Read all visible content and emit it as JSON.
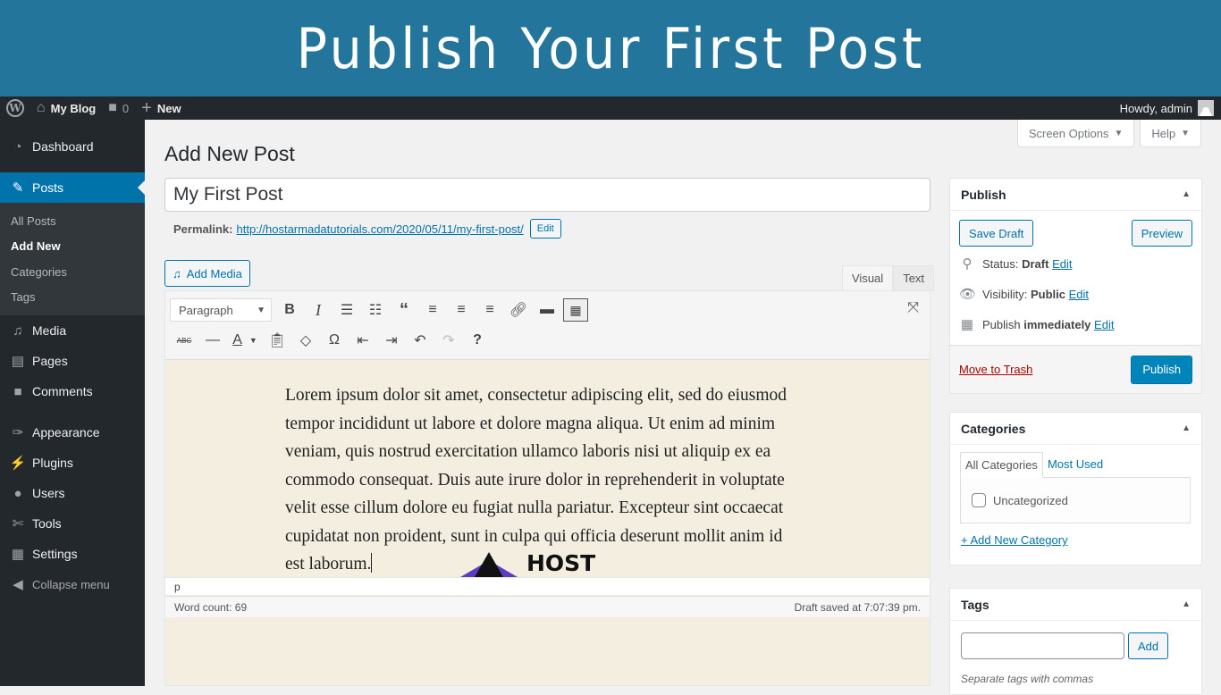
{
  "banner": {
    "title": "Publish Your First Post"
  },
  "adminbar": {
    "site_name": "My Blog",
    "comments_count": "0",
    "new_label": "New",
    "greeting": "Howdy, admin"
  },
  "sidebar": {
    "items": [
      {
        "label": "Dashboard",
        "icon": "dashboard-icon"
      },
      {
        "label": "Posts",
        "icon": "pin-icon",
        "active": true
      },
      {
        "label": "Media",
        "icon": "media-icon"
      },
      {
        "label": "Pages",
        "icon": "pages-icon"
      },
      {
        "label": "Comments",
        "icon": "comment-icon"
      },
      {
        "label": "Appearance",
        "icon": "paintbrush-icon"
      },
      {
        "label": "Plugins",
        "icon": "plugin-icon"
      },
      {
        "label": "Users",
        "icon": "user-icon"
      },
      {
        "label": "Tools",
        "icon": "wrench-icon"
      },
      {
        "label": "Settings",
        "icon": "settings-icon"
      }
    ],
    "submenu": [
      "All Posts",
      "Add New",
      "Categories",
      "Tags"
    ],
    "collapse_label": "Collapse menu"
  },
  "screen_meta": {
    "screen_options": "Screen Options",
    "help": "Help"
  },
  "editor": {
    "page_title": "Add New Post",
    "post_title": "My First Post",
    "permalink_label": "Permalink:",
    "permalink_url": "http://hostarmadatutorials.com/2020/05/11/my-first-post/",
    "permalink_edit": "Edit",
    "add_media": "Add Media",
    "tabs": [
      "Visual",
      "Text"
    ],
    "active_tab": "Visual",
    "format_select": "Paragraph",
    "body": "Lorem ipsum dolor sit amet, consectetur adipiscing elit, sed do eiusmod tempor incididunt ut labore et dolore magna aliqua. Ut enim ad minim veniam, quis nostrud exercitation ullamco laboris nisi ut aliquip ex ea commodo consequat. Duis aute irure dolor in reprehenderit in voluptate velit esse cillum dolore eu fugiat nulla pariatur. Excepteur sint occaecat cupidatat non proident, sunt in culpa qui officia deserunt mollit anim id est laborum.",
    "logo_text": "HOST",
    "path": "p",
    "word_count": "Word count: 69",
    "draft_saved": "Draft saved at 7:07:39 pm."
  },
  "publish": {
    "title": "Publish",
    "save_draft": "Save Draft",
    "preview": "Preview",
    "status_label": "Status:",
    "status_value": "Draft",
    "visibility_label": "Visibility:",
    "visibility_value": "Public",
    "schedule_label": "Publish",
    "schedule_value": "immediately",
    "edit": "Edit",
    "trash": "Move to Trash",
    "publish_button": "Publish"
  },
  "categories": {
    "title": "Categories",
    "tabs": [
      "All Categories",
      "Most Used"
    ],
    "items": [
      {
        "label": "Uncategorized",
        "checked": false
      }
    ],
    "add_new": "+ Add New Category"
  },
  "tags": {
    "title": "Tags",
    "input_value": "",
    "add_button": "Add",
    "hint": "Separate tags with commas"
  },
  "colors": {
    "accent": "#0073aa",
    "primary_button": "#0085ba",
    "banner": "#23759b",
    "admin_dark": "#23282d",
    "editor_bg": "#f4eee1",
    "trash": "#aa0000"
  }
}
